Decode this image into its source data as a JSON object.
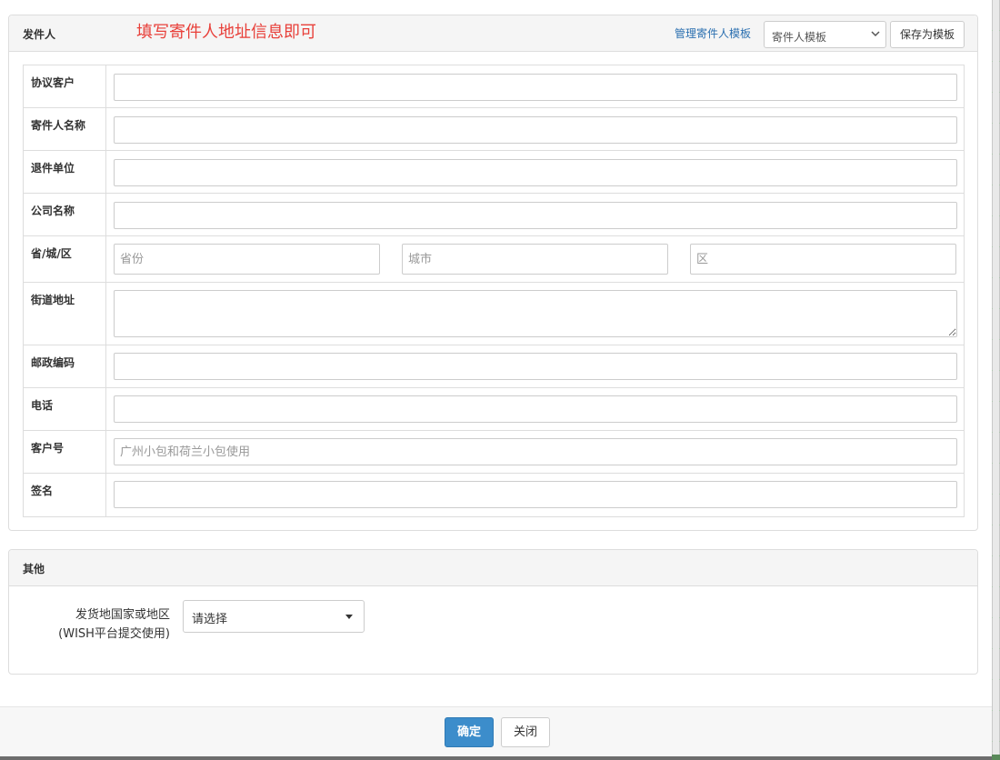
{
  "sender_panel": {
    "title": "发件人",
    "hint": "填写寄件人地址信息即可",
    "manage_link": "管理寄件人模板",
    "template_select": "寄件人模板",
    "save_template_button": "保存为模板",
    "rows": {
      "agreement_customer": {
        "label": "协议客户",
        "value": ""
      },
      "sender_name": {
        "label": "寄件人名称",
        "value": ""
      },
      "return_unit": {
        "label": "退件单位",
        "value": ""
      },
      "company_name": {
        "label": "公司名称",
        "value": ""
      },
      "region": {
        "label": "省/城/区",
        "province_placeholder": "省份",
        "city_placeholder": "城市",
        "district_placeholder": "区"
      },
      "street": {
        "label": "街道地址",
        "value": ""
      },
      "postcode": {
        "label": "邮政编码",
        "value": ""
      },
      "phone": {
        "label": "电话",
        "value": ""
      },
      "customer_no": {
        "label": "客户号",
        "placeholder": "广州小包和荷兰小包使用"
      },
      "signature": {
        "label": "签名",
        "value": ""
      }
    }
  },
  "other_panel": {
    "title": "其他",
    "country_label_line1": "发货地国家或地区",
    "country_label_line2": "(WISH平台提交使用)",
    "country_select": "请选择"
  },
  "footer": {
    "ok_button": "确定",
    "close_button": "关闭"
  },
  "colors": {
    "hint": "#e8403a",
    "link": "#2a6fb0",
    "primary_button": "#3c8dcb"
  }
}
